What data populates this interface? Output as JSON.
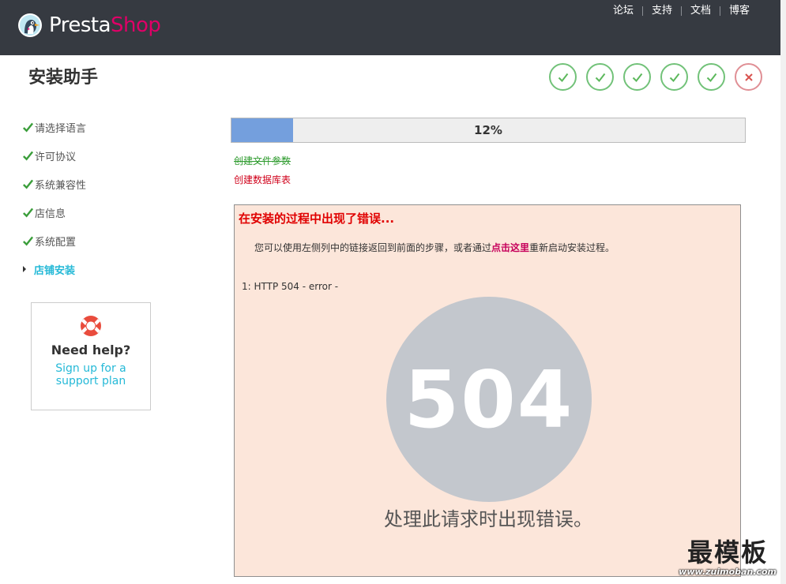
{
  "header": {
    "logo": {
      "part1": "Presta",
      "part2": "Shop"
    },
    "nav": [
      {
        "label": "论坛"
      },
      {
        "label": "支持"
      },
      {
        "label": "文档"
      },
      {
        "label": "博客"
      }
    ]
  },
  "page": {
    "title": "安装助手"
  },
  "steps": [
    {
      "status": "done",
      "icon": "check-icon"
    },
    {
      "status": "done",
      "icon": "check-icon"
    },
    {
      "status": "done",
      "icon": "check-icon"
    },
    {
      "status": "done",
      "icon": "check-icon"
    },
    {
      "status": "done",
      "icon": "check-icon"
    },
    {
      "status": "failed",
      "icon": "close-icon"
    }
  ],
  "sidebar": {
    "items": [
      {
        "label": "请选择语言",
        "state": "done"
      },
      {
        "label": "许可协议",
        "state": "done"
      },
      {
        "label": "系统兼容性",
        "state": "done"
      },
      {
        "label": "店信息",
        "state": "done"
      },
      {
        "label": "系统配置",
        "state": "done"
      },
      {
        "label": "店铺安装",
        "state": "active"
      }
    ]
  },
  "help": {
    "title": "Need help?",
    "link": "Sign up for a support plan"
  },
  "progress": {
    "percent": 12,
    "label": "12%"
  },
  "tasks": {
    "done": "创建文件参数",
    "failed": "创建数据库表"
  },
  "error": {
    "title": "在安装的过程中出现了错误...",
    "message_before": "您可以使用左侧列中的链接返回到前面的步骤，或者通过",
    "message_link": "点击这里",
    "message_after": "重新启动安装过程。",
    "detail": "1: HTTP 504 - error -",
    "code": "504",
    "caption": "处理此请求时出现错误。"
  },
  "watermark": {
    "big": "最模板",
    "small": "www.zuimoban.com"
  },
  "colors": {
    "header_bg": "#363a41",
    "brand_pink": "#df0067",
    "accent": "#25b9d7",
    "success": "#72c279",
    "failed": "#e08f95",
    "error_bg": "#fce6da",
    "progress_fill": "#749fdd"
  }
}
